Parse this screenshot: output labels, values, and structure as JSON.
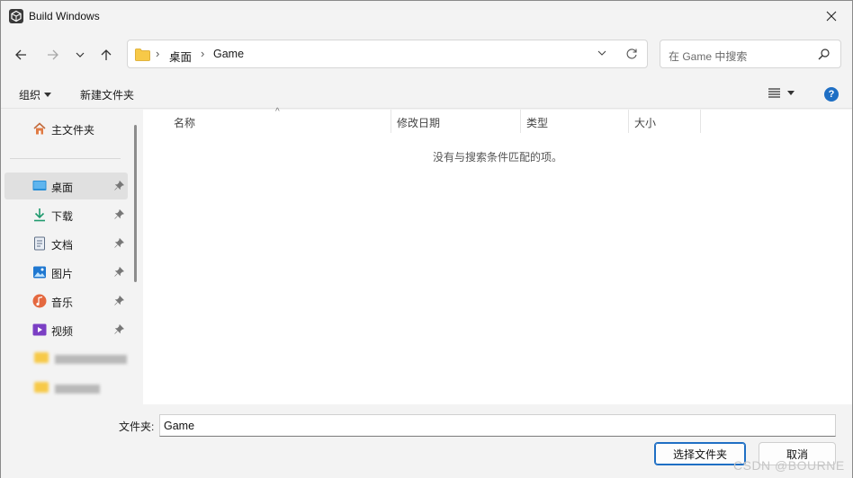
{
  "window": {
    "title": "Build Windows"
  },
  "address_bar": {
    "crumbs": [
      "桌面",
      "Game"
    ]
  },
  "search": {
    "placeholder": "在 Game 中搜索"
  },
  "command_bar": {
    "organize_label": "组织",
    "new_folder_label": "新建文件夹"
  },
  "nav_pane": {
    "home_label": "主文件夹",
    "items": [
      {
        "label": "桌面",
        "icon": "desktop-icon",
        "pinned": true,
        "selected": true
      },
      {
        "label": "下载",
        "icon": "download-icon",
        "pinned": true
      },
      {
        "label": "文档",
        "icon": "document-icon",
        "pinned": true
      },
      {
        "label": "图片",
        "icon": "pictures-icon",
        "pinned": true
      },
      {
        "label": "音乐",
        "icon": "music-icon",
        "pinned": true
      },
      {
        "label": "视频",
        "icon": "video-icon",
        "pinned": true
      }
    ]
  },
  "file_list": {
    "columns": [
      "名称",
      "修改日期",
      "类型",
      "大小"
    ],
    "empty_message": "没有与搜索条件匹配的项。"
  },
  "footer": {
    "folder_label": "文件夹:",
    "folder_value": "Game",
    "select_button": "选择文件夹",
    "cancel_button": "取消"
  },
  "watermark": "CSDN @BOURNE",
  "colors": {
    "accent": "#1f6fc4",
    "folder": "#f7c948"
  }
}
